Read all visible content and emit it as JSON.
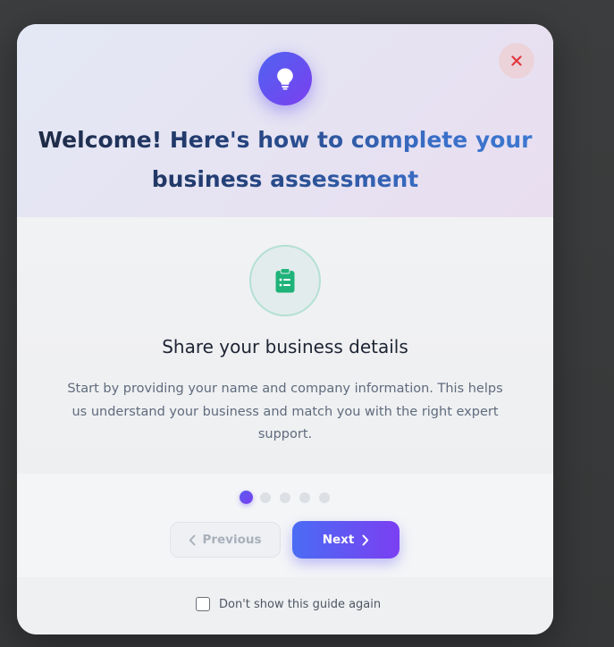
{
  "header": {
    "title": "Welcome! Here's how to complete your business assessment",
    "icon": "lightbulb-icon",
    "close_icon": "close-icon"
  },
  "step": {
    "icon": "clipboard-list-icon",
    "title": "Share your business details",
    "description": "Start by providing your name and company information. This helps us understand your business and match you with the right expert support."
  },
  "progress": {
    "current_step": 1,
    "total_steps": 5
  },
  "navigation": {
    "previous_label": "Previous",
    "next_label": "Next",
    "previous_disabled": true
  },
  "footer": {
    "dont_show_label": "Don't show this guide again",
    "dont_show_checked": false
  },
  "colors": {
    "accent_start": "#4a6cf4",
    "accent_end": "#7b3ff2",
    "close_icon": "#e0383e",
    "step_icon": "#1fb37a"
  }
}
